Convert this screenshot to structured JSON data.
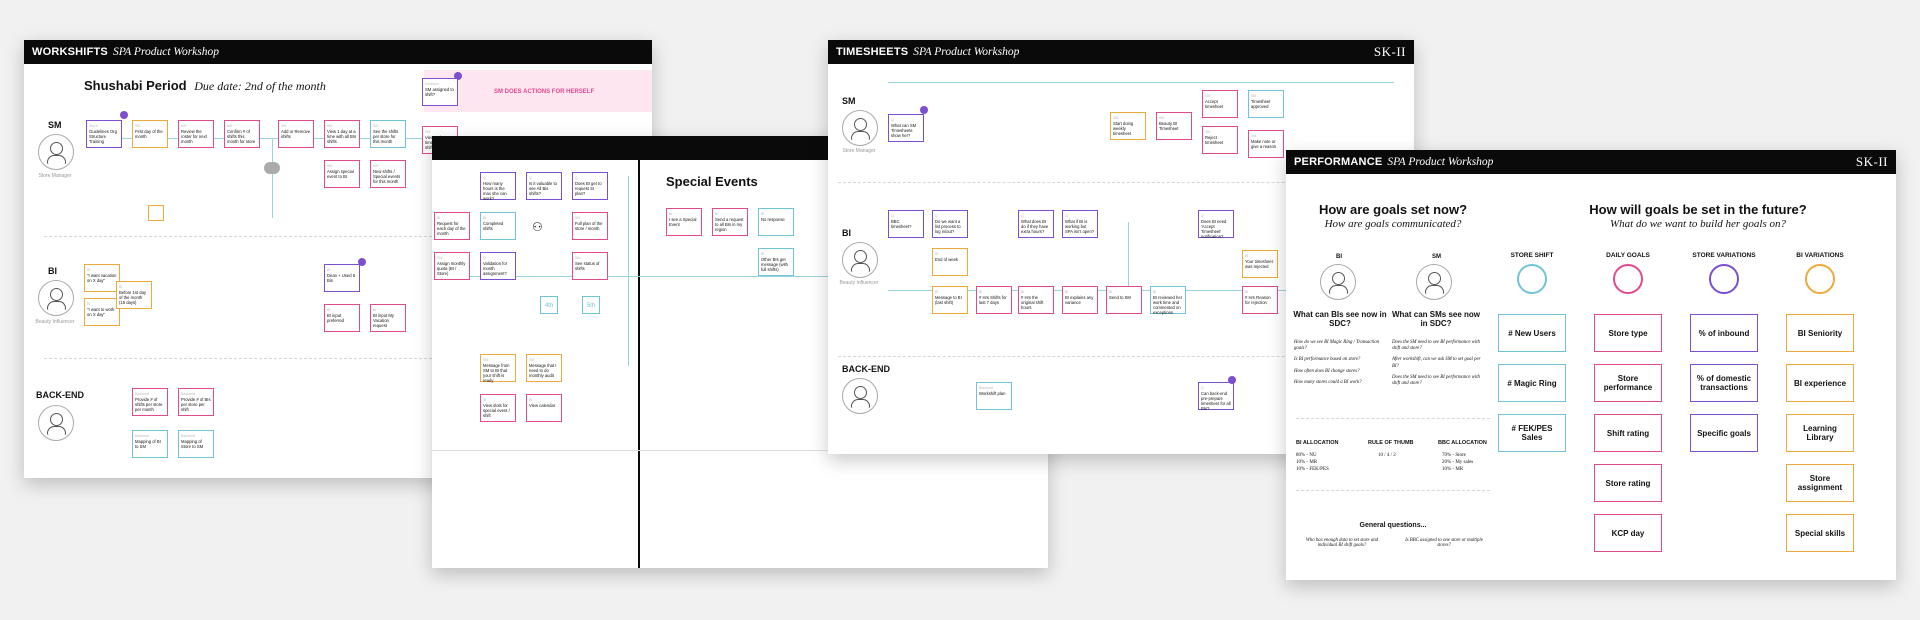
{
  "colors": {
    "pink": "#e24a8e",
    "purple": "#7b4fcf",
    "cyan": "#6fc4d8",
    "orange": "#f0a93b",
    "bar": "#0a0a0a"
  },
  "workshifts": {
    "bar_bold": "WORKSHIFTS",
    "bar_italic": "SPA Product Workshop",
    "period": "Shushabi Period",
    "due": "Due date: 2nd of the month",
    "banner": "SM DOES ACTIONS FOR HERSELF",
    "lanes": {
      "sm": "SM",
      "bi": "BI",
      "backend": "BACK-END"
    },
    "roles": {
      "sm": "Store Manager",
      "bi": "Beauty Influencer"
    },
    "cards": {
      "c1": "Guidelines Org Structure Training",
      "c2": "First day of the month",
      "c3": "Review the roster for next month",
      "c4": "Confirm # of shifts this month for store",
      "c5": "Add or Remove shifts",
      "c6": "Assign special event to BI",
      "c7": "New shifts / Special events for this month",
      "c8": "See the shifts per store for this month",
      "c9": "SM assigned to shift?",
      "c10": "View 1 day at a time with all BIs shifts",
      "b1": "\"I want vacation on X day\"",
      "b2": "\"I want to work on X day\"",
      "b3": "Before 1st day of the month (15 days)",
      "b4": "Dean + Used 8 Bis",
      "b5": "BI input preferred",
      "b6": "BI input My Vacation request",
      "e1": "Provide # of shifts per store per month",
      "e2": "Provide # of BIs per store per shift",
      "e3": "Mapping of BI to SM",
      "e4": "Mapping of Store to SM"
    }
  },
  "middle": {
    "title": "Special Events",
    "cards": {
      "m1": "How many hours is the max she can work?",
      "m2": "Is it valuable to see All Bis shifts?",
      "m3": "Does BI get to request SI plan?",
      "m4": "Request for each day of the month",
      "m5": "Completed shifts",
      "m6": "Assign monthly quota (BI / Store)",
      "m7": "Validation for month assignment?",
      "m8": "Full plan of the store / month",
      "m9": "See status of shifts",
      "m10": "Message from SM to BI that your shift is ready",
      "m11": "Message that I need to do monthly audit",
      "m12": "View slots for special event / shift",
      "m13": "View calendar",
      "s1": "I see a Special Event",
      "s2": "Send a request to all BIs in my region",
      "s3": "No response",
      "s4": "Other BIs get message (with full shifts)"
    },
    "day_a": "4th",
    "day_b": "5th"
  },
  "timesheets": {
    "bar_bold": "TIMESHEETS",
    "bar_italic": "SPA Product Workshop",
    "logo": "SK-II",
    "lanes": {
      "sm": "SM",
      "bi": "BI",
      "backend": "BACK-END"
    },
    "roles": {
      "sm": "Store Manager",
      "bi": "Beauty Influencer"
    },
    "cards": {
      "t1": "BBC timesheet?",
      "t2": "What can SM Timesheets show her?",
      "t3": "Start doing weekly timesheet",
      "t4": "Beauty BI Timesheet",
      "t5": "Accept timesheet",
      "t6": "Reject timesheet",
      "t7": "Timesheet approved",
      "t8": "Make note or give a reason",
      "t9": "Do we want a list process to log in/out?",
      "t10": "End of week",
      "t11": "Message to BI (last shift)",
      "t12": "# Hrs Shifts for last 7 days",
      "t13": "# Hrs the original shift hours",
      "t14": "What does BI do if they have extra hours?",
      "t15": "What if BI is working but SPA isn't open?",
      "t16": "BI explains any variance",
      "t17": "Send to SM",
      "t18": "BI reviewed her work time and commented on exceptions",
      "t19": "Does BI need 'Accept Timesheet' notification?",
      "t20": "Your timesheet was rejected",
      "t21": "# Hrs Reason for rejection",
      "t22": "Workshift plan",
      "t23": "Can back-end pre-prepare timesheet for all BIs?"
    }
  },
  "performance": {
    "bar_bold": "PERFORMANCE",
    "bar_italic": "SPA Product Workshop",
    "logo": "SK-II",
    "q1": "How are goals set now?",
    "q1_sub": "How are goals communicated?",
    "q2": "How will goals be set in the future?",
    "q2_sub": "What do we want to build her goals on?",
    "bi": "BI",
    "sm": "SM",
    "bi_q": "What can BIs see now in SDC?",
    "sm_q": "What can SMs see now in SDC?",
    "bi_n1": "How do we see BI Magic Ring / Transaction goals?",
    "bi_n2": "Is BI performance based on store?",
    "bi_n3": "How often does BI change stores?",
    "bi_n4": "How many stores could a BI work?",
    "sm_n1": "Does the SM need to see BI performance with shift and store?",
    "sm_n2": "After workshift, can we ask SM to set goal per BI?",
    "sm_n3": "Does the SM need to see BI performance with shift and store?",
    "alloc_h1": "BI ALLOCATION",
    "alloc_h2": "RULE OF THUMB",
    "alloc_h3": "BBC ALLOCATION",
    "alloc_1": "80% - NU",
    "alloc_2": "10% - MR",
    "alloc_3": "10% - FEK/PES",
    "rule": "10 / 4 / 2",
    "bbc_1": "70% - Store",
    "bbc_2": "20% - My sales",
    "bbc_3": "10% - MR",
    "general": "General questions...",
    "gq1": "Who has enough data to set store and individual BI shift goals?",
    "gq2": "Is BBC assigned to one store or multiple stores?",
    "cols": [
      "STORE SHIFT",
      "DAILY GOALS",
      "STORE VARIATIONS",
      "BI VARIATIONS"
    ],
    "store_shift": [
      "# New Users",
      "# Magic Ring",
      "# FEK/PES Sales"
    ],
    "daily_goals": [
      "Store type",
      "Store performance",
      "Shift rating",
      "Store rating",
      "KCP day"
    ],
    "store_var": [
      "% of inbound",
      "% of domestic transactions",
      "Specific goals"
    ],
    "bi_var": [
      "BI Seniority",
      "BI experience",
      "Learning Library",
      "Store assignment",
      "Special skills"
    ]
  }
}
